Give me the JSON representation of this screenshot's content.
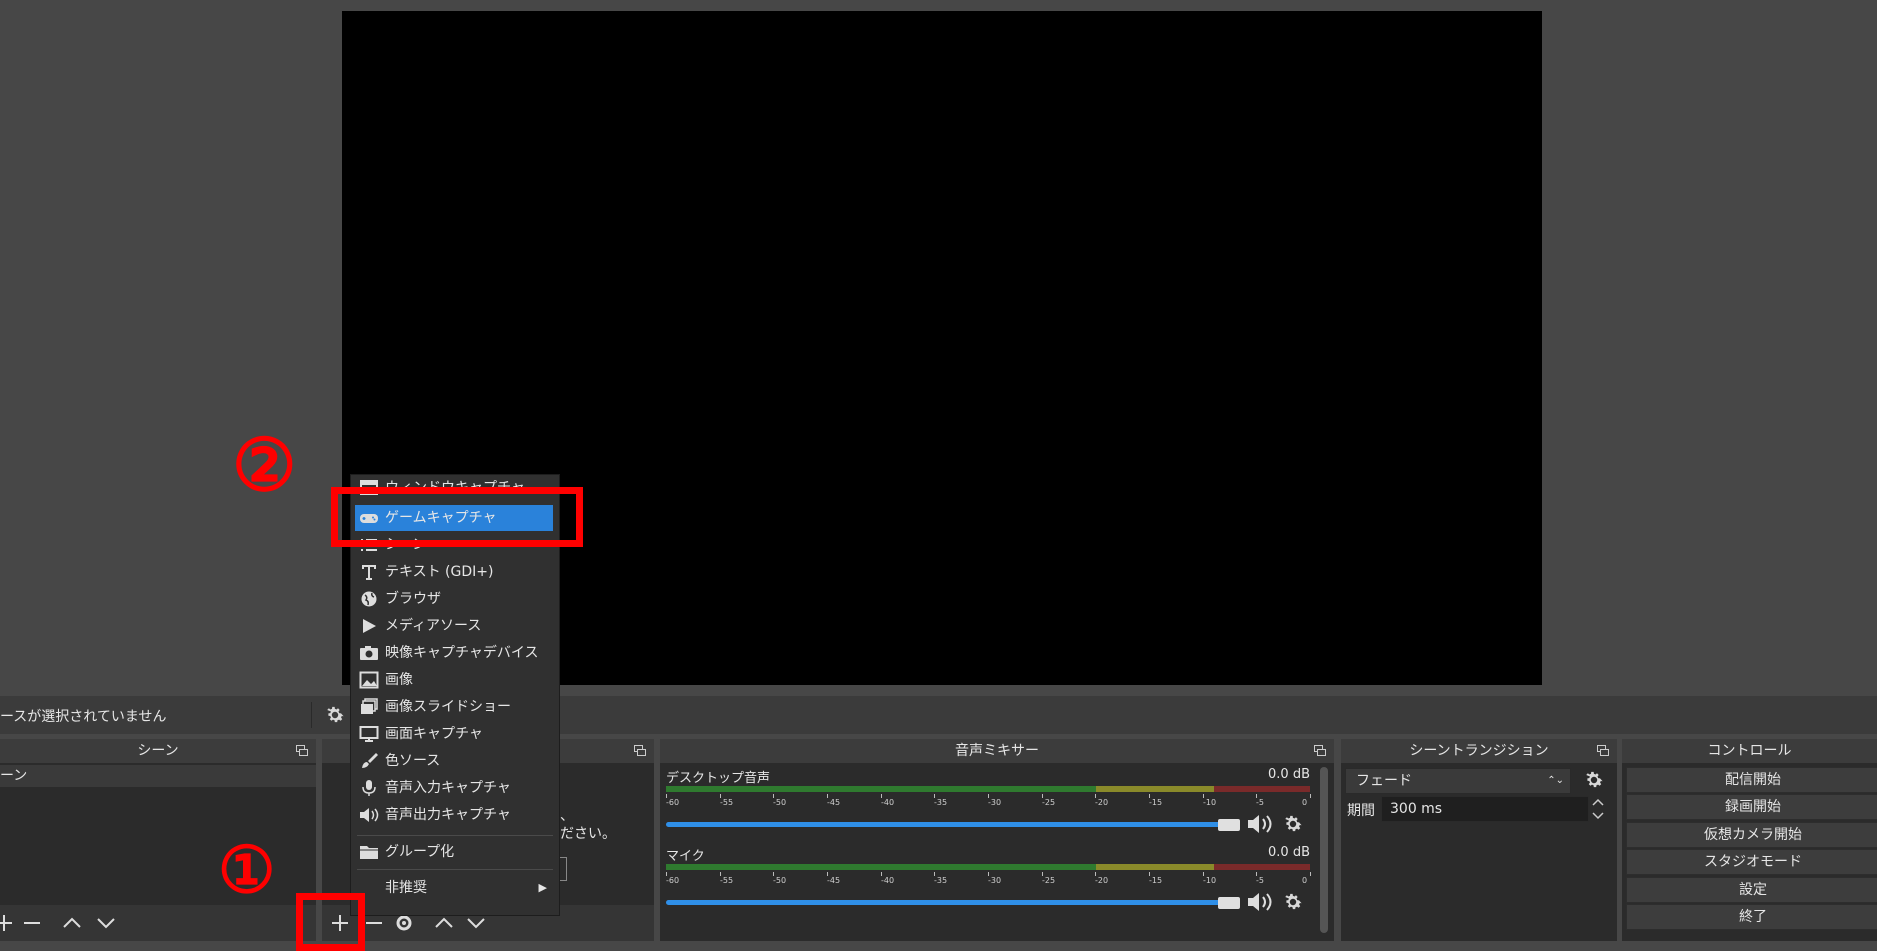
{
  "status": {
    "no_source": "ースが選択されていません"
  },
  "docks": {
    "scenes": {
      "title": "シーン",
      "item": "ーン"
    },
    "sources": {
      "hint1": "、",
      "hint2": "ださい。"
    },
    "mixer": {
      "title": "音声ミキサー",
      "channels": [
        {
          "name": "デスクトップ音声",
          "db": "0.0 dB"
        },
        {
          "name": "マイク",
          "db": "0.0 dB"
        }
      ],
      "ticks": [
        "-60",
        "-55",
        "-50",
        "-45",
        "-40",
        "-35",
        "-30",
        "-25",
        "-20",
        "-15",
        "-10",
        "-5",
        "0"
      ]
    },
    "transitions": {
      "title": "シーントランジション",
      "type": "フェード",
      "duration_label": "期間",
      "duration_value": "300 ms"
    },
    "controls": {
      "title": "コントロール",
      "buttons": [
        "配信開始",
        "録画開始",
        "仮想カメラ開始",
        "スタジオモード",
        "設定",
        "終了"
      ]
    }
  },
  "menu": {
    "items": [
      {
        "label": "ウィンドウキャプチャ",
        "icon": "window-icon"
      },
      {
        "label": "ゲームキャプチャ",
        "icon": "gamepad-icon",
        "selected": true
      },
      {
        "label": "シーン",
        "icon": "list-icon"
      },
      {
        "label": "テキスト (GDI+)",
        "icon": "text-icon"
      },
      {
        "label": "ブラウザ",
        "icon": "globe-icon"
      },
      {
        "label": "メディアソース",
        "icon": "play-icon"
      },
      {
        "label": "映像キャプチャデバイス",
        "icon": "camera-icon"
      },
      {
        "label": "画像",
        "icon": "image-icon"
      },
      {
        "label": "画像スライドショー",
        "icon": "slideshow-icon"
      },
      {
        "label": "画面キャプチャ",
        "icon": "monitor-icon"
      },
      {
        "label": "色ソース",
        "icon": "brush-icon"
      },
      {
        "label": "音声入力キャプチャ",
        "icon": "microphone-icon"
      },
      {
        "label": "音声出力キャプチャ",
        "icon": "speaker-icon"
      },
      {
        "label": "グループ化",
        "icon": "folder-icon"
      },
      {
        "label": "非推奨",
        "icon": ""
      }
    ]
  },
  "annotations": {
    "step1": "①",
    "step2": "②"
  }
}
